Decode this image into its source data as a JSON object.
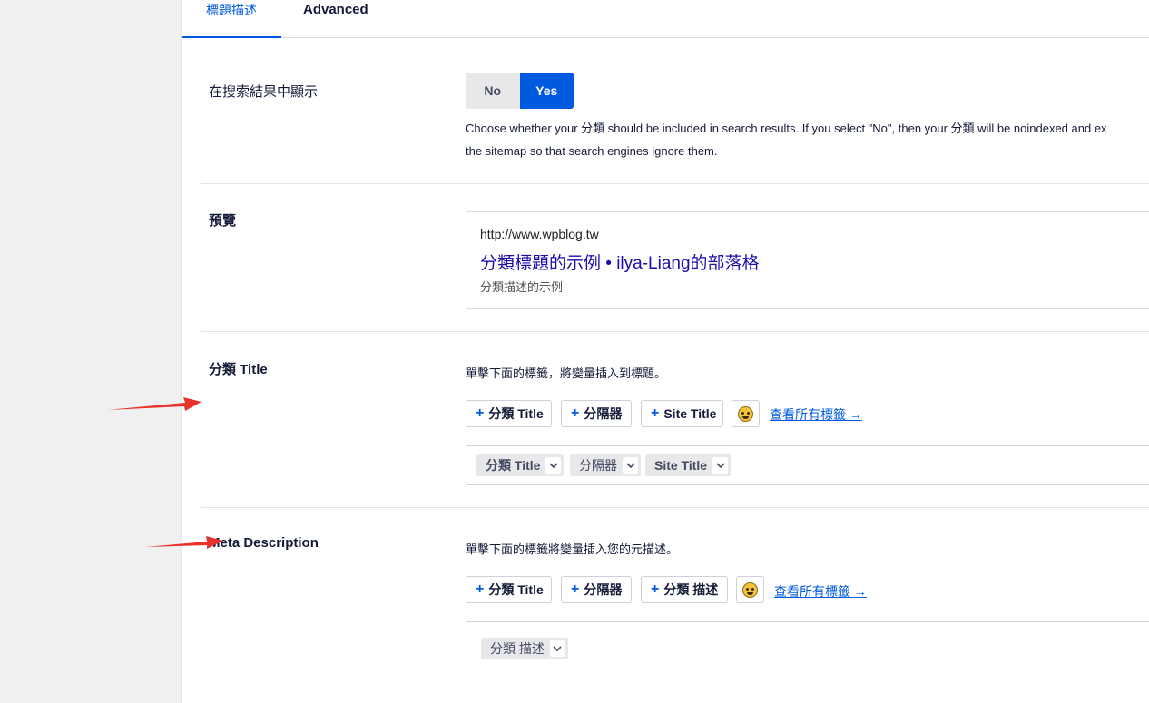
{
  "tabs": {
    "general": "標題描述",
    "advanced": "Advanced"
  },
  "search_visibility": {
    "label": "在搜索結果中顯示",
    "no_label": "No",
    "yes_label": "Yes",
    "description_line1": "Choose whether your 分類 should be included in search results. If you select \"No\", then your 分類 will be noindexed and ex",
    "description_line2": "the sitemap so that search engines ignore them."
  },
  "preview": {
    "label": "預覽",
    "url": "http://www.wpblog.tw",
    "title": "分類標題的示例 • ilya-Liang的部落格",
    "description": "分類描述的示例"
  },
  "title_section": {
    "label": "分類 Title",
    "hint": "單擊下面的標籤，將變量插入到標題。",
    "buttons": [
      "分類 Title",
      "分隔器",
      "Site Title"
    ],
    "view_all": "查看所有標籤 →",
    "chips": [
      "分類 Title",
      "分隔器",
      "Site Title"
    ]
  },
  "meta_section": {
    "label": "Meta Description",
    "hint": "單擊下面的標籤將變量插入您的元描述。",
    "buttons": [
      "分類 Title",
      "分隔器",
      "分類 描述"
    ],
    "view_all": "查看所有標籤 →",
    "chips": [
      "分類 描述"
    ]
  },
  "colors": {
    "accent": "#005ae0",
    "arrow": "#e8322b"
  }
}
